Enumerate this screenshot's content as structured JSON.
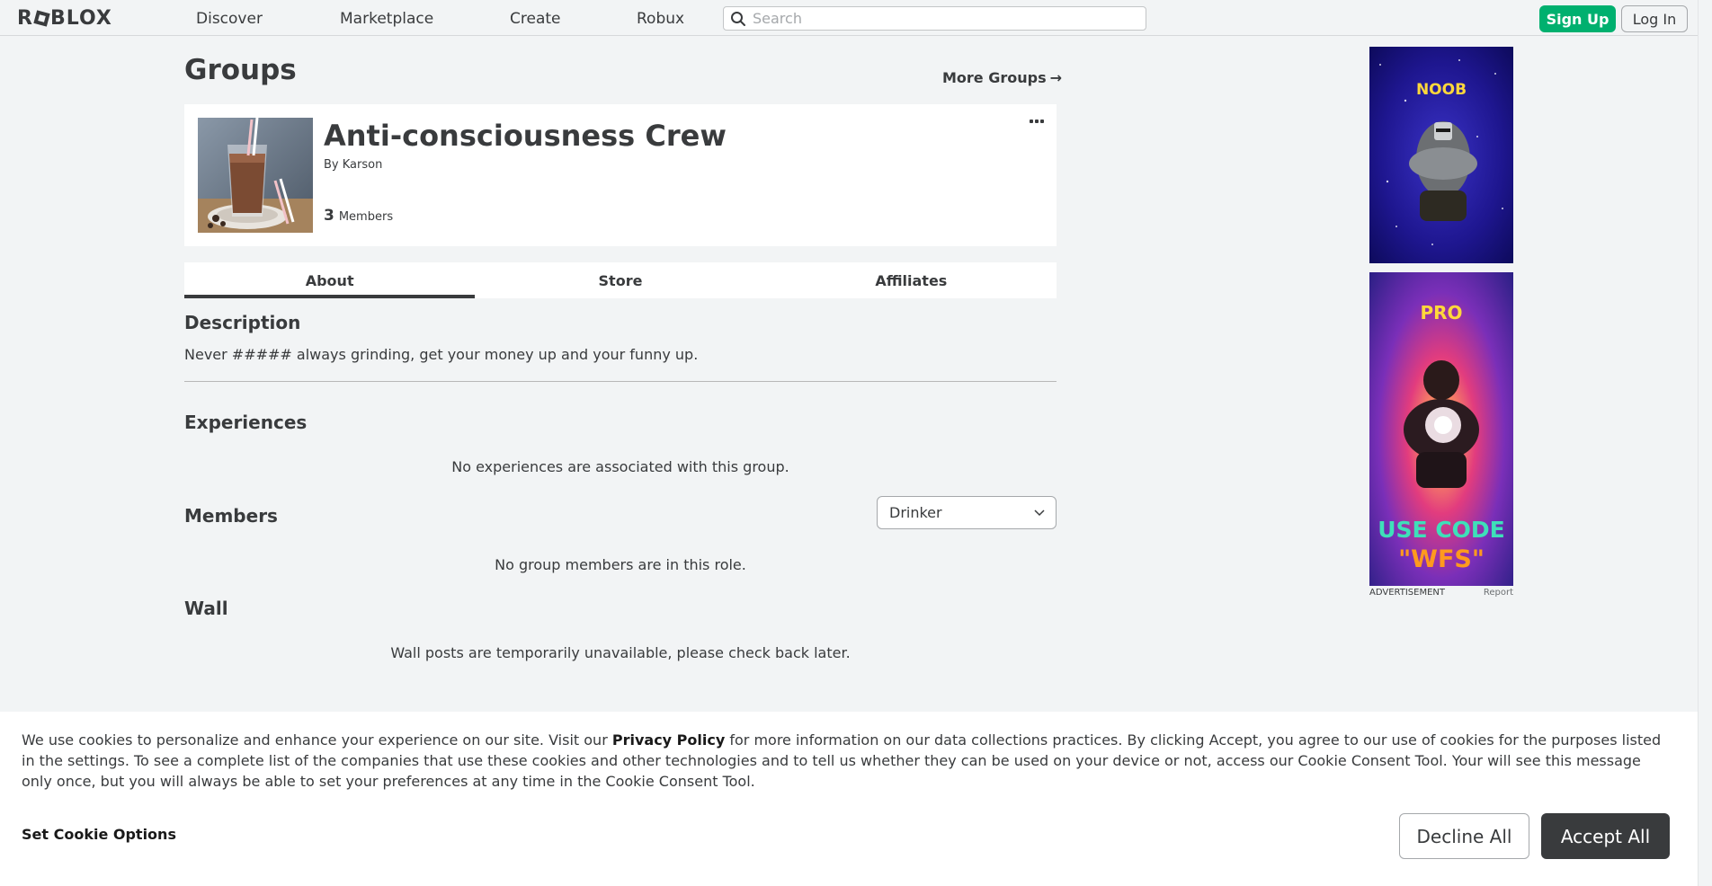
{
  "header": {
    "logo_text_1": "R",
    "logo_text_2": "BLOX",
    "nav": [
      {
        "label": "Discover"
      },
      {
        "label": "Marketplace"
      },
      {
        "label": "Create"
      },
      {
        "label": "Robux"
      }
    ],
    "search_placeholder": "Search",
    "signup_label": "Sign Up",
    "login_label": "Log In"
  },
  "page": {
    "title": "Groups",
    "more_groups": "More Groups",
    "more_groups_arrow": "→"
  },
  "group": {
    "name": "Anti-consciousness Crew",
    "by_prefix": "By",
    "owner": "Karson",
    "member_count": "3",
    "member_label": "Members"
  },
  "tabs": [
    {
      "label": "About",
      "active": true
    },
    {
      "label": "Store",
      "active": false
    },
    {
      "label": "Affiliates",
      "active": false
    }
  ],
  "about": {
    "description_title": "Description",
    "description_text": "Never ##### always grinding, get your money up and your funny up.",
    "experiences_title": "Experiences",
    "experiences_empty": "No experiences are associated with this group.",
    "members_title": "Members",
    "role_selected": "Drinker",
    "members_empty": "No group members are in this role.",
    "wall_title": "Wall",
    "wall_empty": "Wall posts are temporarily unavailable, please check back later."
  },
  "ads": {
    "ad1_text": "NOOB",
    "ad2_top": "PRO",
    "ad2_line1": "USE CODE",
    "ad2_line2": "\"WFS\"",
    "footer_label": "ADVERTISEMENT",
    "report_label": "Report"
  },
  "cookie": {
    "text_before": "We use cookies to personalize and enhance your experience on our site. Visit our ",
    "privacy_link": "Privacy Policy",
    "text_after": " for more information on our data collections practices. By clicking Accept, you agree to our use of cookies for the purposes listed in the settings. To see a complete list of the companies that use these cookies and other technologies and to tell us whether they can be used on your device or not, access our Cookie Consent Tool. Your will see this message only once, but you will always be able to set your preferences at any time in the Cookie Consent Tool.",
    "options_label": "Set Cookie Options",
    "decline_label": "Decline All",
    "accept_label": "Accept All"
  },
  "colors": {
    "signup_green": "#00b06f",
    "accept_dark": "#393b3d",
    "page_bg": "#f2f4f5"
  }
}
